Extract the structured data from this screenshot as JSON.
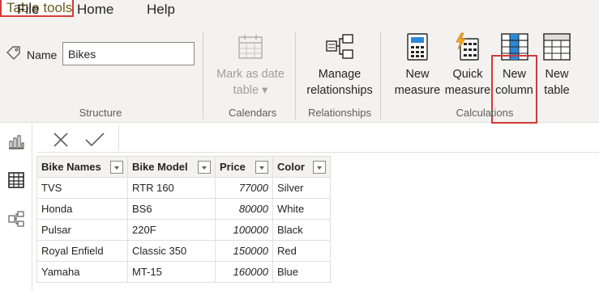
{
  "menu": {
    "file": "File",
    "home": "Home",
    "help": "Help",
    "table_tools": "Table tools"
  },
  "ribbon": {
    "name_label": "Name",
    "name_value": "Bikes",
    "mark_as_date_line1": "Mark as date",
    "mark_as_date_line2": "table ▾",
    "manage_line1": "Manage",
    "manage_line2": "relationships",
    "new_measure_line1": "New",
    "new_measure_line2": "measure",
    "quick_measure_line1": "Quick",
    "quick_measure_line2": "measure",
    "new_column_line1": "New",
    "new_column_line2": "column",
    "new_table_line1": "New",
    "new_table_line2": "table",
    "groups": {
      "structure": "Structure",
      "calendars": "Calendars",
      "relationships": "Relationships",
      "calculations": "Calculations"
    }
  },
  "table": {
    "headers": [
      "Bike Names",
      "Bike Model",
      "Price",
      "Color"
    ],
    "rows": [
      [
        "TVS",
        "RTR 160",
        "77000",
        "Silver"
      ],
      [
        "Honda",
        "BS6",
        "80000",
        "White"
      ],
      [
        "Pulsar",
        "220F",
        "100000",
        "Black"
      ],
      [
        "Royal Enfield",
        "Classic 350",
        "150000",
        "Red"
      ],
      [
        "Yamaha",
        "MT-15",
        "160000",
        "Blue"
      ]
    ]
  },
  "icons": {
    "tag": "tag-icon",
    "calendar": "calendar-icon",
    "relationships": "relationships-icon",
    "calculator": "calculator-icon",
    "quick_measure": "lightning-calculator-icon",
    "new_column": "new-column-icon",
    "new_table": "new-table-icon",
    "report_view": "bar-chart-icon",
    "data_view": "table-grid-icon",
    "model_view": "model-icon",
    "cancel": "close-icon",
    "commit": "check-icon"
  },
  "colors": {
    "accent_highlight": "#d33a3a",
    "ribbon_bg": "#f3f2f1",
    "column_blue": "#2b88d8"
  }
}
